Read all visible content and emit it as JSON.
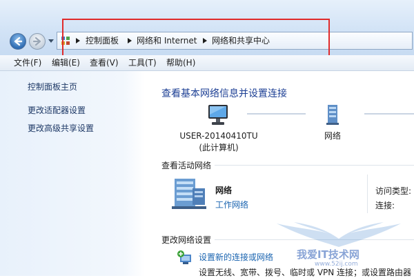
{
  "breadcrumb": [
    "控制面板",
    "网络和 Internet",
    "网络和共享中心"
  ],
  "menu": [
    "文件(F)",
    "编辑(E)",
    "查看(V)",
    "工具(T)",
    "帮助(H)"
  ],
  "sidebar": {
    "items": [
      {
        "label": "控制面板主页"
      },
      {
        "label": "更改适配器设置"
      },
      {
        "label": "更改高级共享设置"
      }
    ]
  },
  "main": {
    "title": "查看基本网络信息并设置连接",
    "map": {
      "computer_name": "USER-20140410TU",
      "computer_sub": "(此计算机)",
      "network_label": "网络"
    },
    "active_networks": {
      "heading": "查看活动网络",
      "name": "网络",
      "type": "工作网络",
      "access_type_label": "访问类型:",
      "connections_label": "连接:"
    },
    "change_settings": {
      "heading": "更改网络设置",
      "setup_link": "设置新的连接或网络",
      "setup_desc": "设置无线、宽带、拨号、临时或 VPN 连接；或设置路由器"
    }
  },
  "watermark": {
    "text": "我爱IT技术网",
    "url": "www.52ij.com"
  },
  "colors": {
    "highlight": "#e02a2a",
    "link": "#1a64b0",
    "title": "#1c3f94"
  }
}
